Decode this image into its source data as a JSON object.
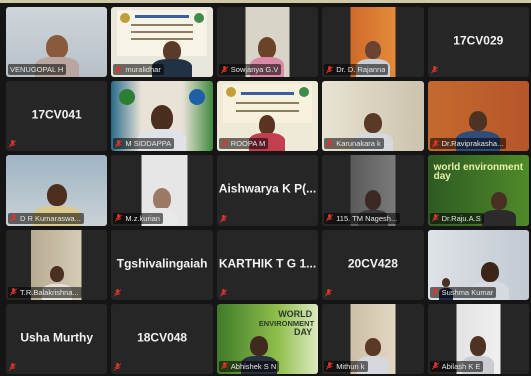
{
  "meeting": {
    "tiles": [
      {
        "type": "video",
        "name": "VENUGOPAL H"
      },
      {
        "type": "video",
        "name": "muralidhar"
      },
      {
        "type": "video",
        "name": "Sowjanya G.V"
      },
      {
        "type": "video",
        "name": "Dr. D. Rajanna"
      },
      {
        "type": "text",
        "name": "17CV029"
      },
      {
        "type": "text",
        "name": "17CV041"
      },
      {
        "type": "video",
        "name": "M SIDDAPPA"
      },
      {
        "type": "video",
        "name": "ROOPA M",
        "active": true
      },
      {
        "type": "video",
        "name": "Karunakara k"
      },
      {
        "type": "video",
        "name": "Dr.Raviprakasha..."
      },
      {
        "type": "video",
        "name": "D R Kumaraswa..."
      },
      {
        "type": "video",
        "name": "M.z.kurian"
      },
      {
        "type": "text",
        "name": "Aishwarya K P(..."
      },
      {
        "type": "video",
        "name": "115. TM Nagesh..."
      },
      {
        "type": "video",
        "name": "Dr.Raju.A.S"
      },
      {
        "type": "video",
        "name": "T.R.Balakrishna..."
      },
      {
        "type": "text",
        "name": "Tgshivalingaiah"
      },
      {
        "type": "text",
        "name": "KARTHIK T G 1..."
      },
      {
        "type": "text",
        "name": "20CV428"
      },
      {
        "type": "video",
        "name": "Sushma Kumar"
      },
      {
        "type": "text",
        "name": "Usha Murthy"
      },
      {
        "type": "text",
        "name": "18CV048"
      },
      {
        "type": "video",
        "name": "Abhishek S N"
      },
      {
        "type": "video",
        "name": "Mithun k"
      },
      {
        "type": "video",
        "name": "Abilash K E"
      }
    ],
    "slide_texts": {
      "department": "Department of Civil Engineering",
      "event": "World Environment Day - 2021",
      "poster_line1": "WORLD",
      "poster_line2": "ENVIRONMENT",
      "poster_line3": "DAY",
      "poster_small": "world environment day"
    }
  },
  "colors": {
    "muted_mic": "#e0342c",
    "active_speaker_border": "#d9e64a",
    "tile_bg": "#262626"
  }
}
